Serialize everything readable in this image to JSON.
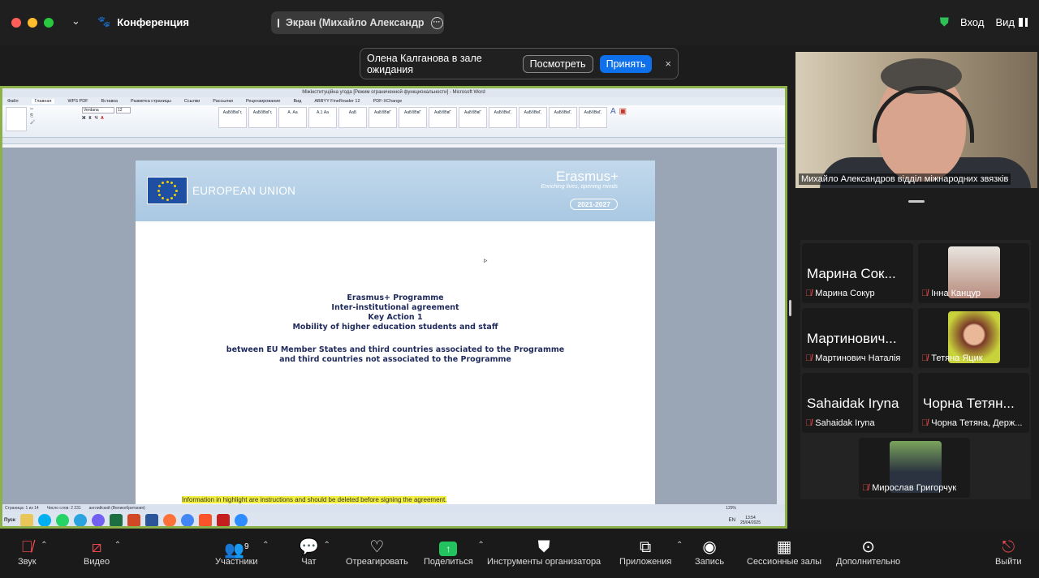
{
  "topbar": {
    "conference_label": "Конференция",
    "screen_label": "Экран (Михайло Александр",
    "login_label": "Вход",
    "view_label": "Вид"
  },
  "waiting": {
    "text": "Олена Калганова в зале ожидания",
    "view_button": "Посмотреть",
    "accept_button": "Принять",
    "close_glyph": "×"
  },
  "word": {
    "window_title": "Міжінституційна угода [Режим ограниченной функциональности] - Microsoft Word",
    "tabs": [
      "Файл",
      "Главная",
      "WPS PDF",
      "Вставка",
      "Разметка страницы",
      "Ссылки",
      "Рассылки",
      "Рецензирование",
      "Вид",
      "ABBYY FineReader 12",
      "PDF-XChange"
    ],
    "font_name": "Verdana",
    "font_size": "12",
    "styles": [
      "АаБбВвГг,",
      "АаБбВвГг,",
      "А. Аа",
      "А.1 Аа",
      "АаБ",
      "АаБбВвГ",
      "АаБбВвГ",
      "АаБбВвГ",
      "АаБбВвГ",
      "АаБбВвГ,",
      "АаБбВвГ,",
      "АаБбВвГ,",
      "АаБбВвГ,"
    ],
    "eu_text": "EUROPEAN UNION",
    "erasmus_logo": "Erasmus+",
    "erasmus_slogan": "Enriching lives, opening minds",
    "years": "2021-2027",
    "title_lines": [
      "Erasmus+ Programme",
      "Inter-institutional agreement",
      "Key Action 1",
      "Mobility of higher education students and staff"
    ],
    "subtitle_lines": [
      "between EU Member States and third countries associated to the Programme",
      "and third countries not associated to the Programme"
    ],
    "highlight_text": "Information in highlight are instructions and should be deleted before signing the agreement.",
    "status_page": "Страница: 1 из 14",
    "status_words": "Число слов: 2 231",
    "status_lang": "английский (Великобритания)",
    "zoom": "129%",
    "taskbar_start": "Пуск",
    "taskbar_lang": "EN",
    "taskbar_time": "13:54",
    "taskbar_date": "25/04/2025"
  },
  "speaker": {
    "name": "Михайло Александров відділ міжнародних звязків"
  },
  "participants": [
    {
      "big": "Марина Сок...",
      "label": "Марина Сокур"
    },
    {
      "big": "",
      "label": "Інна Канцур"
    },
    {
      "big": "Мартинович...",
      "label": "Мартинович Наталія"
    },
    {
      "big": "",
      "label": "Тетяна Яцик"
    },
    {
      "big": "Sahaidak Iryna",
      "label": "Sahaidak Iryna"
    },
    {
      "big": "Чорна Тетян...",
      "label": "Чорна Тетяна, Держ..."
    },
    {
      "big": "",
      "label": "Мирослав Григорчук"
    }
  ],
  "toolbar": {
    "audio": "Звук",
    "video": "Видео",
    "participants": "Участники",
    "participants_count": "9",
    "chat": "Чат",
    "react": "Отреагировать",
    "share": "Поделиться",
    "host_tools": "Инструменты организатора",
    "apps": "Приложения",
    "record": "Запись",
    "breakout": "Сессионные залы",
    "more": "Дополнительно",
    "leave": "Выйти"
  }
}
